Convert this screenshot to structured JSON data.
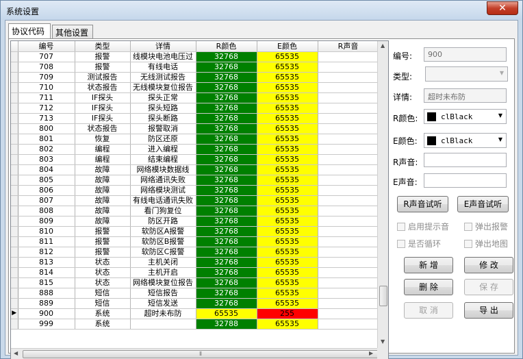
{
  "window": {
    "title": "系统设置",
    "close_label": "✕"
  },
  "tabs": [
    {
      "label": "协议代码",
      "active": true
    },
    {
      "label": "其他设置",
      "active": false
    }
  ],
  "grid": {
    "columns": [
      "编号",
      "类型",
      "详情",
      "R颜色",
      "E颜色",
      "R声音"
    ],
    "rows": [
      [
        "707",
        "报警",
        "线模块电池电压过",
        "32768",
        "65535"
      ],
      [
        "708",
        "报警",
        "有线电话",
        "32768",
        "65535"
      ],
      [
        "709",
        "测试报告",
        "无线测试报告",
        "32768",
        "65535"
      ],
      [
        "710",
        "状态报告",
        "无线模块复位报告",
        "32768",
        "65535"
      ],
      [
        "711",
        "IF探头",
        "探头正常",
        "32768",
        "65535"
      ],
      [
        "712",
        "IF探头",
        "探头短路",
        "32768",
        "65535"
      ],
      [
        "713",
        "IF探头",
        "探头断路",
        "32768",
        "65535"
      ],
      [
        "800",
        "状态报告",
        "报警取消",
        "32768",
        "65535"
      ],
      [
        "801",
        "恢复",
        "防区还原",
        "32768",
        "65535"
      ],
      [
        "802",
        "编程",
        "进入编程",
        "32768",
        "65535"
      ],
      [
        "803",
        "编程",
        "结束编程",
        "32768",
        "65535"
      ],
      [
        "804",
        "故障",
        "网络模块数据线",
        "32768",
        "65535"
      ],
      [
        "805",
        "故障",
        "网络通讯失败",
        "32768",
        "65535"
      ],
      [
        "806",
        "故障",
        "网络模块测试",
        "32768",
        "65535"
      ],
      [
        "807",
        "故障",
        "有线电话通讯失败",
        "32768",
        "65535"
      ],
      [
        "808",
        "故障",
        "看门狗复位",
        "32768",
        "65535"
      ],
      [
        "809",
        "故障",
        "防区开路",
        "32768",
        "65535"
      ],
      [
        "810",
        "报警",
        "软防区A报警",
        "32768",
        "65535"
      ],
      [
        "811",
        "报警",
        "软防区B报警",
        "32768",
        "65535"
      ],
      [
        "812",
        "报警",
        "软防区C报警",
        "32768",
        "65535"
      ],
      [
        "813",
        "状态",
        "主机关闭",
        "32768",
        "65535"
      ],
      [
        "814",
        "状态",
        "主机开启",
        "32768",
        "65535"
      ],
      [
        "815",
        "状态",
        "网络模块复位报告",
        "32768",
        "65535"
      ],
      [
        "888",
        "短信",
        "短信报告",
        "32768",
        "65535"
      ],
      [
        "889",
        "短信",
        "短信发送",
        "32768",
        "65535"
      ],
      [
        "900",
        "系统",
        "超时未布防",
        "65535",
        "255"
      ],
      [
        "999",
        "系统",
        "",
        "32788",
        "65535"
      ]
    ],
    "selected_row_indicator": "▶",
    "hscroll_grip": "⦀"
  },
  "form": {
    "code_label": "编号:",
    "code_value": "900",
    "type_label": "类型:",
    "type_value": "",
    "detail_label": "详情:",
    "detail_value": "超时未布防",
    "rcolor_label": "R颜色:",
    "rcolor_value": "clBlack",
    "ecolor_label": "E颜色:",
    "ecolor_value": "clBlack",
    "rsound_label": "R声音:",
    "rsound_value": "",
    "esound_label": "E声音:",
    "esound_value": "",
    "rsound_test": "R声音试听",
    "esound_test": "E声音试听",
    "cb_prompt": "启用提示音",
    "cb_popup_alarm": "弹出报警",
    "cb_loop": "是否循环",
    "cb_popup_map": "弹出地图",
    "btn_add": "新 增",
    "btn_edit": "修 改",
    "btn_delete": "删 除",
    "btn_save": "保 存",
    "btn_cancel": "取 消",
    "btn_export": "导 出"
  },
  "colors": {
    "green": "#008000",
    "yellow": "#ffff00",
    "red": "#ff0000"
  }
}
